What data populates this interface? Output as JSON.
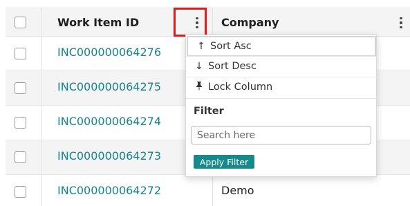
{
  "grid": {
    "columns": [
      {
        "label": "Work Item ID"
      },
      {
        "label": "Company"
      }
    ],
    "rows": [
      {
        "work_item_id": "INC000000064276",
        "company": ""
      },
      {
        "work_item_id": "INC000000064275",
        "company": ""
      },
      {
        "work_item_id": "INC000000064274",
        "company": ""
      },
      {
        "work_item_id": "INC000000064273",
        "company": ""
      },
      {
        "work_item_id": "INC000000064272",
        "company": "Demo"
      }
    ]
  },
  "column_menu": {
    "sort_asc": "Sort Asc",
    "sort_desc": "Sort Desc",
    "lock_column": "Lock Column",
    "filter_title": "Filter",
    "search_placeholder": "Search here",
    "apply_filter": "Apply Filter",
    "icons": {
      "sort_asc": "arrow-up-icon",
      "sort_desc": "arrow-down-icon",
      "lock": "pin-icon"
    }
  },
  "colors": {
    "link": "#14838f",
    "accent_button": "#168a8a",
    "highlight": "#e41a1a",
    "header_bg": "#f4f4f4"
  }
}
